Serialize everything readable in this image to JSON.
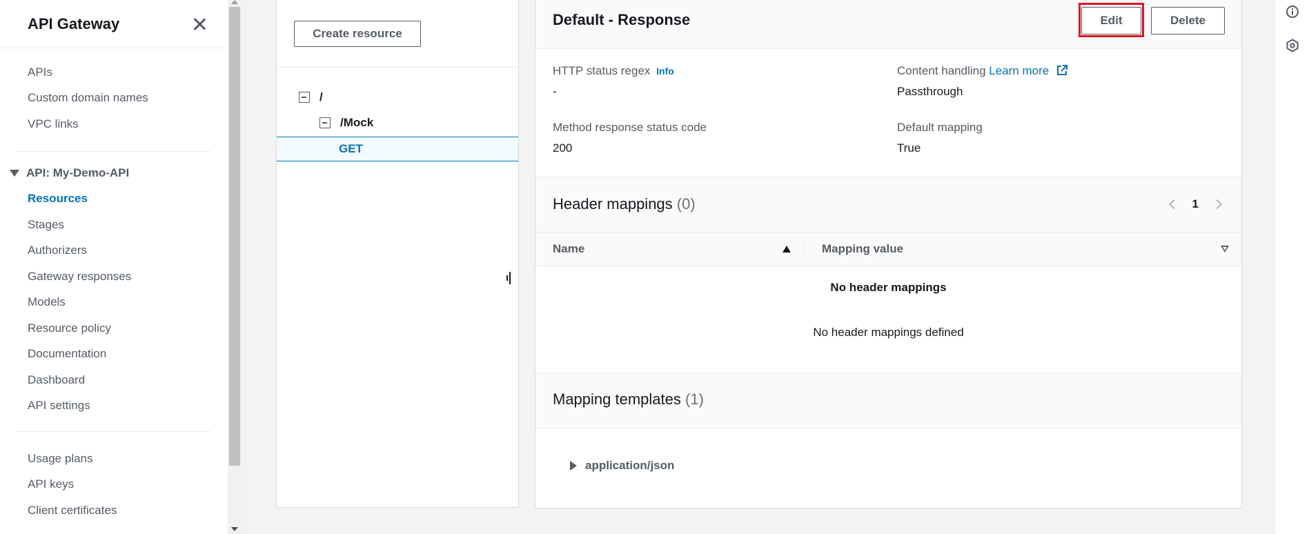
{
  "sidebar": {
    "title": "API Gateway",
    "group1": [
      "APIs",
      "Custom domain names",
      "VPC links"
    ],
    "api_section_title": "API: My-Demo-API",
    "api_items": [
      "Resources",
      "Stages",
      "Authorizers",
      "Gateway responses",
      "Models",
      "Resource policy",
      "Documentation",
      "Dashboard",
      "API settings"
    ],
    "group3": [
      "Usage plans",
      "API keys",
      "Client certificates"
    ]
  },
  "tree": {
    "create_resource_label": "Create resource",
    "root": "/",
    "child": "/Mock",
    "method": "GET"
  },
  "detail": {
    "title": "Default - Response",
    "edit_label": "Edit",
    "delete_label": "Delete",
    "http_status_regex_label": "HTTP status regex",
    "info_label": "Info",
    "http_status_regex_value": "-",
    "content_handling_label": "Content handling",
    "learn_more_label": "Learn more",
    "content_handling_value": "Passthrough",
    "method_status_label": "Method response status code",
    "method_status_value": "200",
    "default_mapping_label": "Default mapping",
    "default_mapping_value": "True",
    "header_mappings_title": "Header mappings",
    "header_mappings_count": "(0)",
    "page_number": "1",
    "col_name": "Name",
    "col_mapping_value": "Mapping value",
    "empty_title": "No header mappings",
    "empty_desc": "No header mappings defined",
    "mapping_templates_title": "Mapping templates",
    "mapping_templates_count": "(1)",
    "template_item": "application/json"
  },
  "colors": {
    "link": "#0073bb",
    "highlight_border": "#e0141e"
  }
}
